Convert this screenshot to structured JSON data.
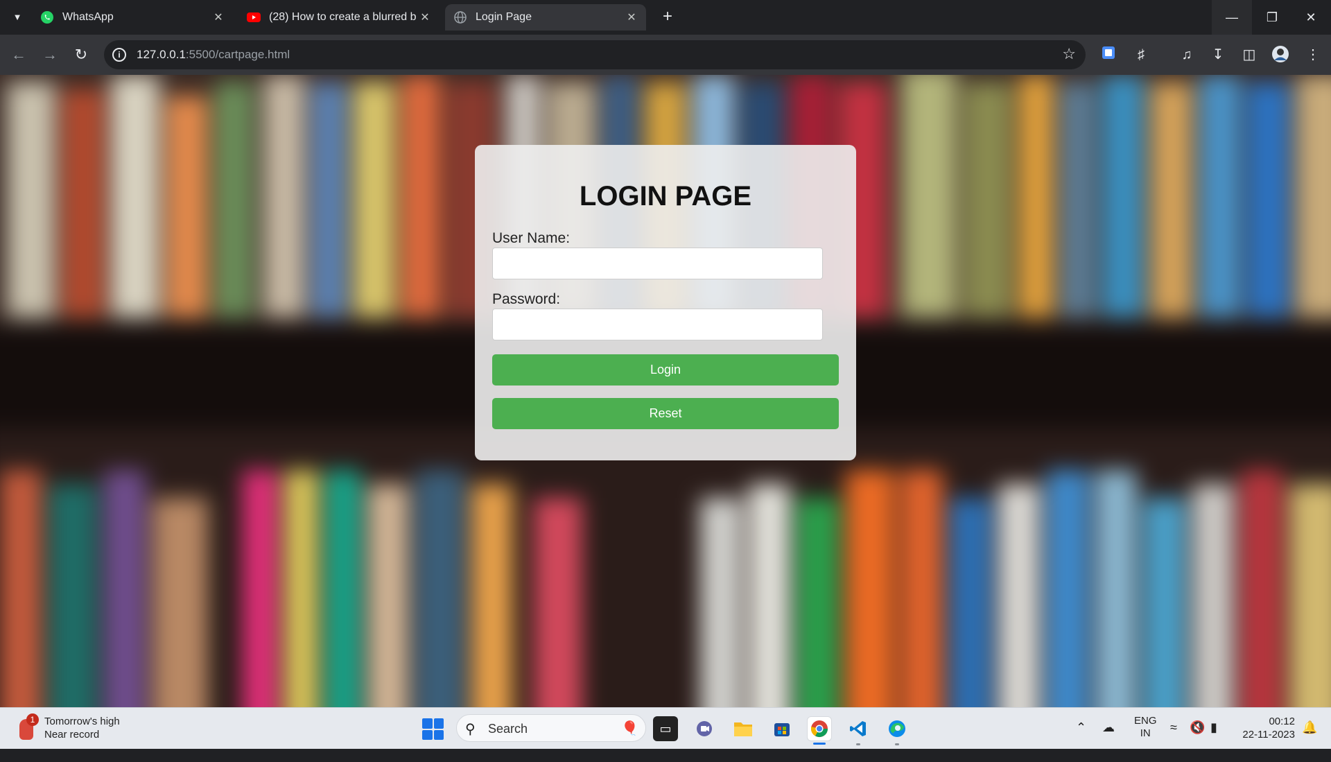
{
  "browser": {
    "tabs": [
      {
        "title": "WhatsApp",
        "icon": "whatsapp-icon",
        "close": "✕"
      },
      {
        "title": "(28) How to create a blurred b",
        "icon": "youtube-icon",
        "close": "✕"
      },
      {
        "title": "Login Page",
        "icon": "globe-icon",
        "close": "✕"
      }
    ],
    "address": {
      "host": "127.0.0.1",
      "rest": ":5500/cartpage.html"
    }
  },
  "login": {
    "heading": "LOGIN PAGE",
    "username_label": "User Name:",
    "username_value": "",
    "password_label": "Password:",
    "password_value": "",
    "login_button": "Login",
    "reset_button": "Reset",
    "button_color": "#4caf50"
  },
  "taskbar": {
    "weather": {
      "badge": "1",
      "line1": "Tomorrow's high",
      "line2": "Near record"
    },
    "search_placeholder": "Search",
    "apps": [
      "file-explorer-icon",
      "teams-icon",
      "folder-icon",
      "store-icon",
      "chrome-icon",
      "vscode-icon",
      "edge-icon"
    ],
    "tray": {
      "lang1": "ENG",
      "lang2": "IN",
      "time": "00:12",
      "date": "22-11-2023"
    }
  }
}
